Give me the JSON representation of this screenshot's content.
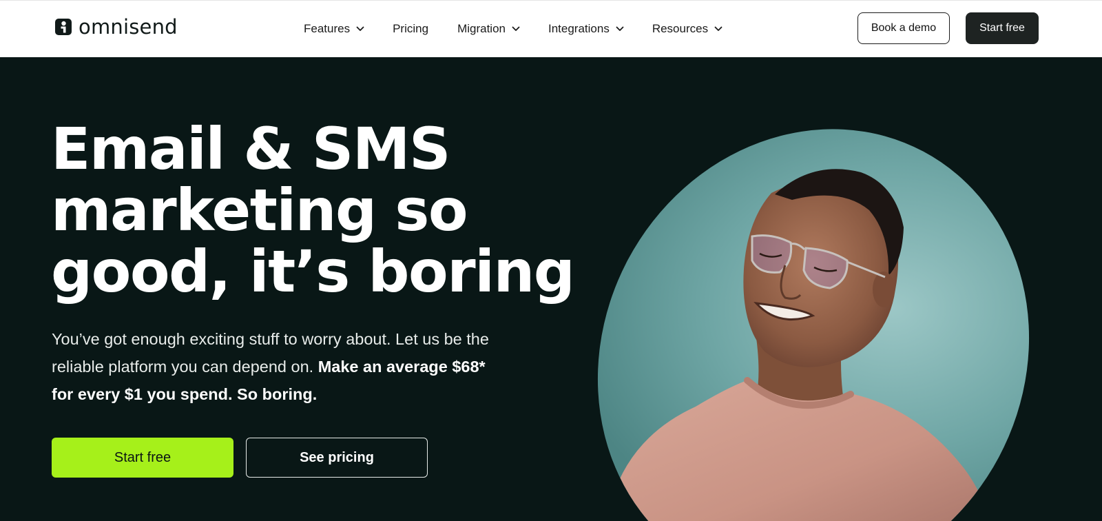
{
  "brand": {
    "name": "omnisend",
    "logo_icon": "omnisend-logo-mark"
  },
  "nav": {
    "items": [
      {
        "label": "Features",
        "has_dropdown": true
      },
      {
        "label": "Pricing",
        "has_dropdown": false
      },
      {
        "label": "Migration",
        "has_dropdown": true
      },
      {
        "label": "Integrations",
        "has_dropdown": true
      },
      {
        "label": "Resources",
        "has_dropdown": true
      }
    ],
    "book_demo_label": "Book a demo",
    "start_free_label": "Start free"
  },
  "hero": {
    "title_lines": [
      "Email & SMS",
      "marketing so",
      "good, it’s boring"
    ],
    "subtitle_light": "You’ve got enough exciting stuff to worry about. Let us be the reliable platform you can depend on.",
    "subtitle_bold": "Make an average $68* for every $1 you spend. So boring.",
    "primary_cta": "Start free",
    "secondary_cta": "See pricing",
    "image_icon": "smiling-man-portrait"
  },
  "colors": {
    "hero_background": "#091716",
    "accent_green": "#a6f01a",
    "nav_background": "#ffffff",
    "dark_button": "#1e2322",
    "photo_background": "#5f9c9c"
  }
}
